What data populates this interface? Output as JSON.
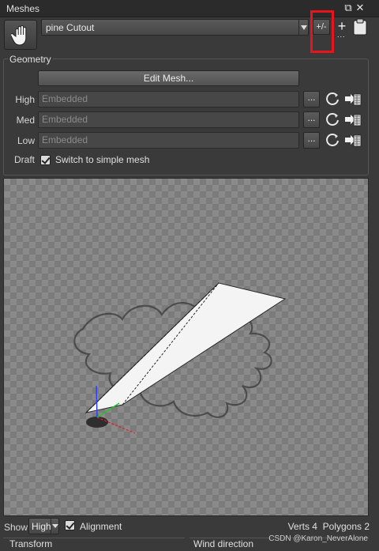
{
  "window": {
    "title": "Meshes",
    "restore_icon": "restore-window-icon",
    "close_icon": "close-icon"
  },
  "toolbar": {
    "hand_icon": "hand-icon",
    "mesh_name": "pine Cutout",
    "plus_minus_label": "+/-",
    "add_label": "+",
    "add_dots": "...",
    "clipboard_icon": "clipboard-icon"
  },
  "geometry": {
    "label": "Geometry",
    "edit_mesh_label": "Edit Mesh...",
    "lods": [
      {
        "label": "High",
        "value": "Embedded",
        "browse": "..."
      },
      {
        "label": "Med",
        "value": "Embedded",
        "browse": "..."
      },
      {
        "label": "Low",
        "value": "Embedded",
        "browse": "..."
      }
    ],
    "draft_label": "Draft",
    "draft_checkbox_label": "Switch to simple mesh",
    "draft_checked": true
  },
  "bottom": {
    "show_label": "Show",
    "lod_value": "High",
    "alignment_label": "Alignment",
    "alignment_checked": true,
    "verts_text": "Verts 4",
    "polygons_text": "Polygons 2"
  },
  "lower": {
    "transform_label": "Transform",
    "wind_label": "Wind direction"
  },
  "watermark": "CSDN @Karon_NeverAlone",
  "colors": {
    "highlight_box": "#e8141b",
    "axis_x": "#e02020",
    "axis_y": "#2a3cff",
    "axis_z": "#22c22a"
  }
}
